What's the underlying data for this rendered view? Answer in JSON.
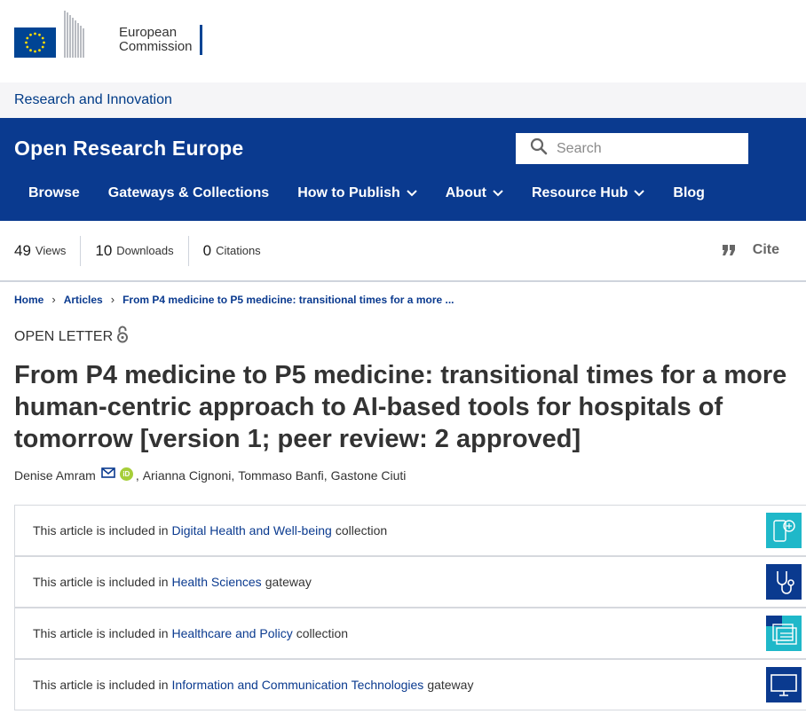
{
  "header": {
    "org_line1": "European",
    "org_line2": "Commission",
    "subtitle": "Research and Innovation"
  },
  "site": {
    "title": "Open Research Europe",
    "search_placeholder": "Search"
  },
  "nav": [
    {
      "label": "Browse"
    },
    {
      "label": "Gateways & Collections"
    },
    {
      "label": "How to Publish"
    },
    {
      "label": "About"
    },
    {
      "label": "Resource Hub"
    },
    {
      "label": "Blog"
    }
  ],
  "metrics": [
    {
      "value": "49",
      "label": "Views"
    },
    {
      "value": "10",
      "label": "Downloads"
    },
    {
      "value": "0",
      "label": "Citations"
    }
  ],
  "cite_label": "Cite",
  "breadcrumb": [
    "Home",
    "Articles",
    "From P4 medicine to P5 medicine: transitional times for a more ..."
  ],
  "article": {
    "type": "OPEN LETTER",
    "title": "From P4 medicine to P5 medicine: transitional times for a more human-centric approach to AI-based tools for hospitals of tomorrow [version 1; peer review: 2 approved]",
    "authors": [
      "Denise Amram",
      "Arianna Cignoni",
      "Tommaso Banfi",
      "Gastone Ciuti"
    ]
  },
  "collections": [
    {
      "prefix": "This article is included in",
      "link": "Digital Health and Well-being",
      "suffix": "collection",
      "color": "#1fb8c9",
      "icon": "phone-health-icon"
    },
    {
      "prefix": "This article is included in",
      "link": "Health Sciences",
      "suffix": "gateway",
      "color": "#0a3a8f",
      "icon": "stethoscope-icon"
    },
    {
      "prefix": "This article is included in",
      "link": "Healthcare and Policy",
      "suffix": "collection",
      "color": "#1fb8c9",
      "icon": "documents-icon"
    },
    {
      "prefix": "This article is included in",
      "link": "Information and Communication Technologies",
      "suffix": "gateway",
      "color": "#0a3a8f",
      "icon": "monitor-icon"
    }
  ],
  "colors": {
    "brand": "#0a3a8f",
    "accent": "#1fb8c9",
    "orcid": "#a6ce39"
  }
}
